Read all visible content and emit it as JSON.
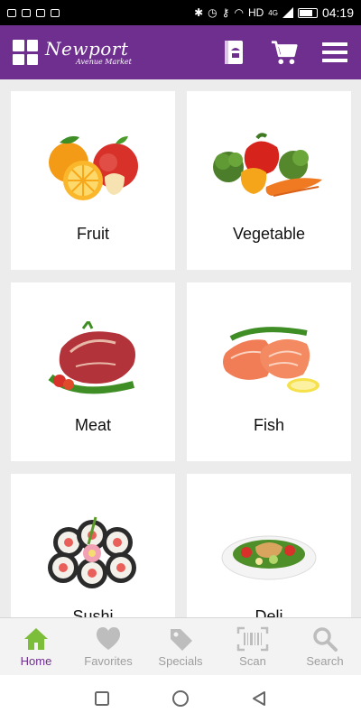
{
  "status_bar": {
    "network": "HD",
    "network_type": "4G",
    "time": "04:19"
  },
  "app": {
    "brand": "Newport",
    "tagline": "Avenue Market"
  },
  "categories": [
    {
      "label": "Fruit"
    },
    {
      "label": "Vegetable"
    },
    {
      "label": "Meat"
    },
    {
      "label": "Fish"
    },
    {
      "label": "Sushi"
    },
    {
      "label": "Deli"
    }
  ],
  "bottom_nav": [
    {
      "label": "Home",
      "icon": "home-icon",
      "active": true
    },
    {
      "label": "Favorites",
      "icon": "heart-icon"
    },
    {
      "label": "Specials",
      "icon": "tag-icon"
    },
    {
      "label": "Scan",
      "icon": "barcode-icon"
    },
    {
      "label": "Search",
      "icon": "search-icon"
    }
  ],
  "colors": {
    "brand_purple": "#6e2f8e",
    "home_green": "#7cbd3a",
    "inactive_gray": "#9e9e9e"
  }
}
